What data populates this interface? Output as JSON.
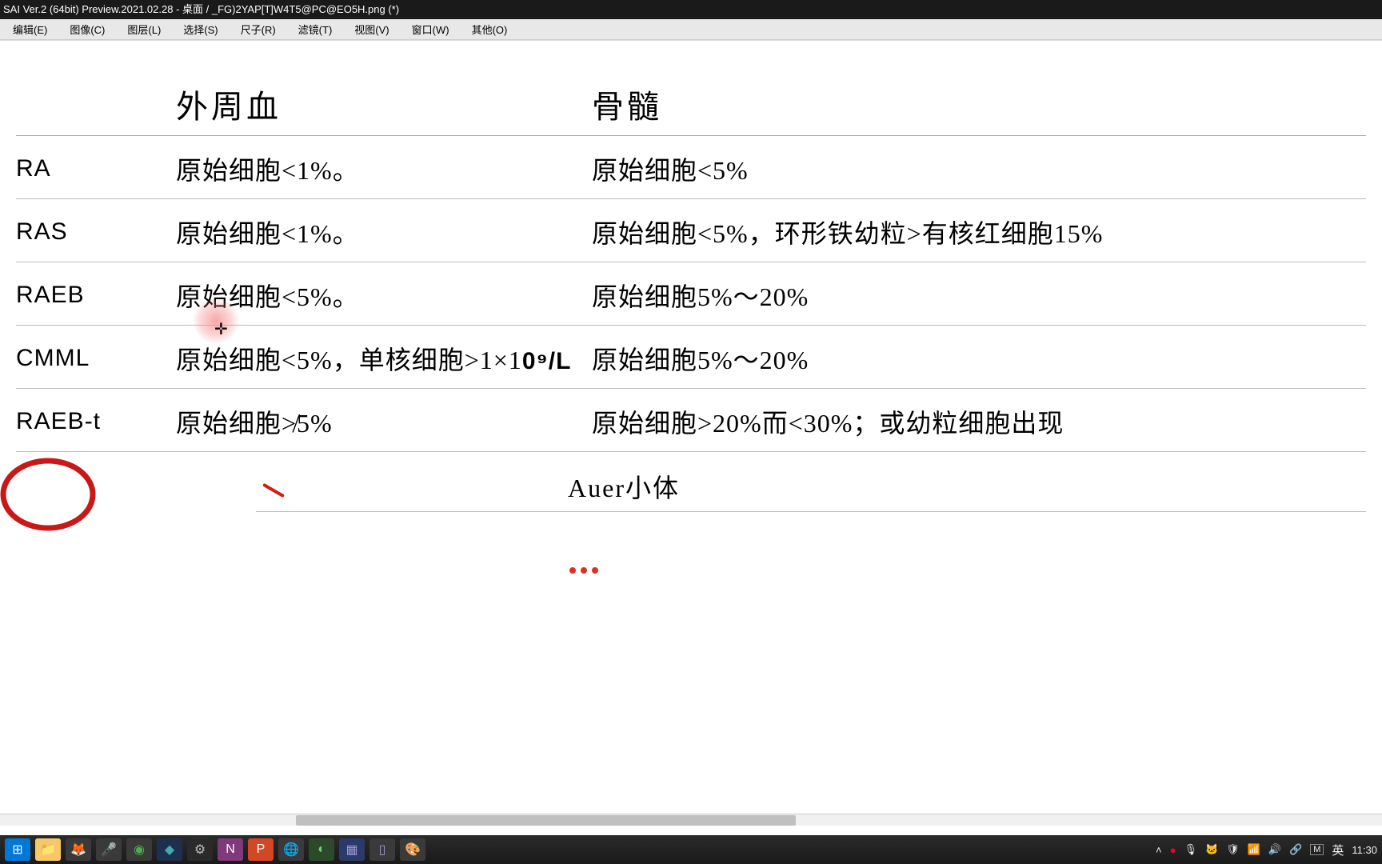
{
  "titlebar": "SAI Ver.2 (64bit) Preview.2021.02.28 - 桌面 / _FG)2YAP[T]W4T5@PC@EO5H.png (*)",
  "menu": {
    "edit": "编辑(E)",
    "image": "图像(C)",
    "layer": "图层(L)",
    "select": "选择(S)",
    "ruler": "尺子(R)",
    "filter": "滤镜(T)",
    "view": "视图(V)",
    "window": "窗口(W)",
    "other": "其他(O)"
  },
  "headers": {
    "col1": "外周血",
    "col2": "骨髓"
  },
  "rows": [
    {
      "label": "RA",
      "col1": "原始细胞<1%。",
      "col2": "原始细胞<5%"
    },
    {
      "label": "RAS",
      "col1": "原始细胞<1%。",
      "col2": "原始细胞<5%，环形铁幼粒>有核红细胞15%"
    },
    {
      "label": "RAEB",
      "col1": "原始细胞<5%。",
      "col2": "原始细胞5%～20%"
    },
    {
      "label": "CMML",
      "col1_a": "原始细胞<5%，单核细胞>1×1",
      "col1_b": "0⁹/L",
      "col2": "原始细胞5%～20%"
    },
    {
      "label": "RAEB-t",
      "col1": "原始细胞≯5%",
      "col2": "原始细胞>20%而<30%；或幼粒细胞出现"
    }
  ],
  "footer": "Auer小体",
  "tray": {
    "ime1": "M",
    "ime2": "英",
    "time": "11:30"
  },
  "taskbar_icons": [
    {
      "name": "start",
      "bg": "#0078d7",
      "glyph": "⊞",
      "color": "#fff"
    },
    {
      "name": "explorer",
      "bg": "#f7c869",
      "glyph": "📁"
    },
    {
      "name": "firefox",
      "bg": "#3a3a3a",
      "glyph": "🦊"
    },
    {
      "name": "mic",
      "bg": "#3a3a3a",
      "glyph": "🎤",
      "color": "#bbb"
    },
    {
      "name": "chrome",
      "bg": "#3a3a3a",
      "glyph": "◉",
      "color": "#4caf50"
    },
    {
      "name": "vscode",
      "bg": "#1e3050",
      "glyph": "◆",
      "color": "#4aa"
    },
    {
      "name": "settings",
      "bg": "#2a2a2a",
      "glyph": "⚙",
      "color": "#bbb"
    },
    {
      "name": "onenote",
      "bg": "#80397b",
      "glyph": "N",
      "color": "#fff"
    },
    {
      "name": "ppt",
      "bg": "#d24726",
      "glyph": "P",
      "color": "#fff"
    },
    {
      "name": "browser",
      "bg": "#3a3a3a",
      "glyph": "🌐"
    },
    {
      "name": "app1",
      "bg": "#2a4a2a",
      "glyph": "◐",
      "color": "#7c7"
    },
    {
      "name": "app2",
      "bg": "#2a3a6a",
      "glyph": "▦",
      "color": "#99c"
    },
    {
      "name": "app3",
      "bg": "#3a3a3a",
      "glyph": "▯",
      "color": "#99c"
    },
    {
      "name": "sai",
      "bg": "#3a3a3a",
      "glyph": "🎨"
    }
  ]
}
